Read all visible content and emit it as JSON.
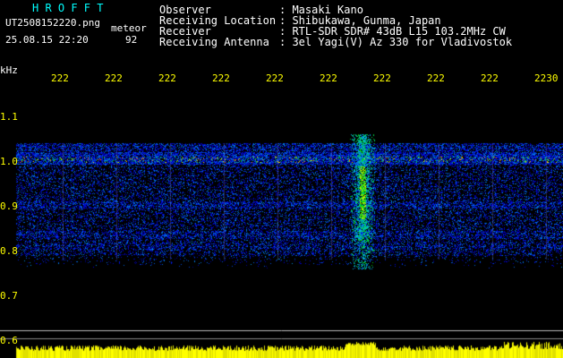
{
  "header": {
    "app_title": "H R O F F T",
    "file_name": "UT2508152220.png",
    "mode": "meteor",
    "timestamp": "25.08.15 22:20",
    "count": "92",
    "labels": [
      "Observer",
      "Receiving Location",
      "Receiver",
      "Receiving Antenna"
    ],
    "values": [
      ": Masaki Kano",
      ": Shibukawa, Gunma, Japan",
      ": RTL-SDR SDR# 43dB L15 103.2MHz CW",
      ": 3el Yagi(V) Az 330 for Vladivostok"
    ]
  },
  "axis": {
    "unit": "kHz",
    "time_ticks": [
      "222",
      "222",
      "222",
      "222",
      "222",
      "222",
      "222",
      "222",
      "222",
      "2230"
    ],
    "freq_ticks": [
      "1.1",
      "1.0",
      "0.9",
      "0.8",
      "0.7",
      "0.6"
    ]
  },
  "colors": {
    "background": "#000000",
    "text": "#ffffff",
    "title": "#00ffff",
    "ticks": "#ffff00"
  }
}
